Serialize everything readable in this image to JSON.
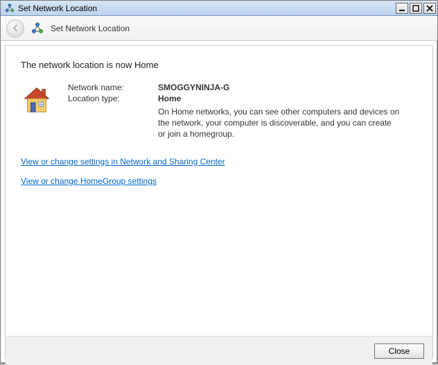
{
  "titlebar": {
    "title": "Set Network Location"
  },
  "header": {
    "title": "Set Network Location"
  },
  "main": {
    "heading": "The network location is now Home",
    "network_name_label": "Network name:",
    "network_name_value": "SMOGGYNINJA-G",
    "location_type_label": "Location type:",
    "location_type_value": "Home",
    "description": "On Home networks, you can see other computers and devices on the network, your computer is discoverable, and you can create or join a homegroup.",
    "link_network_sharing": "View or change settings in Network and Sharing Center",
    "link_homegroup": "View or change HomeGroup settings"
  },
  "footer": {
    "close_label": "Close"
  }
}
